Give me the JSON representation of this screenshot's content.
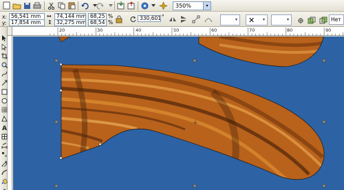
{
  "toolbar": {
    "zoom_value": "350%",
    "zoom_dropdown_arrow": "▾"
  },
  "property_bar": {
    "x_label": "x:",
    "x_value": "56,541 mm",
    "y_label": "y:",
    "y_value": "17,854 mm",
    "width_value": "74,144 mm",
    "height_value": "32,275 mm",
    "scale_x": "68,25",
    "scale_y": "68,54",
    "pct_x": "%",
    "pct_y": "%",
    "rotation_value": "330,601",
    "rotation_unit": "°",
    "outline_none_label": "Нет",
    "combo_arrow": "▾"
  },
  "rulers": {
    "top_labels": [
      "20",
      "30",
      "40",
      "50",
      "60",
      "70",
      "80",
      "90"
    ]
  },
  "canvas": {
    "background_color": "#2d63a5",
    "object_name": "wood-textured-knife-handle"
  },
  "colors": {
    "toolbar_bg": "#ece9d8",
    "field_border": "#7f9db9",
    "canvas_blue": "#2d63a5",
    "wood_dark": "#5a2b0a",
    "wood_light": "#d98a2e"
  }
}
